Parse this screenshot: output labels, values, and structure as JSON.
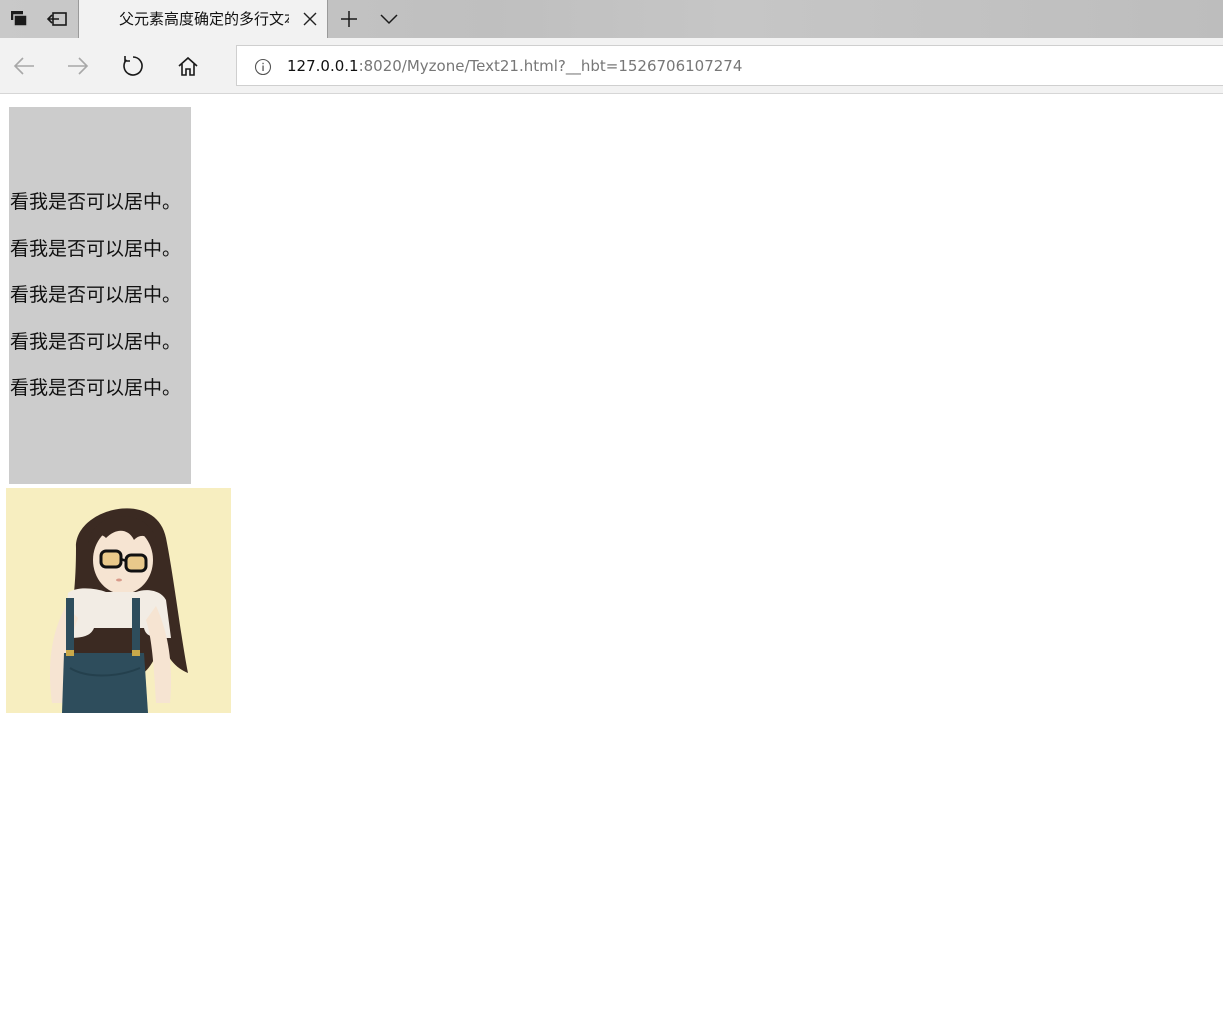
{
  "browser": {
    "tab": {
      "title": "父元素高度确定的多行文本垂直居中"
    },
    "toolbar_icons": [
      "tab-manager-icon",
      "set-aside-tabs-icon",
      "new-tab-icon",
      "tab-preview-chevron-icon"
    ],
    "nav_icons": [
      "back-arrow-icon",
      "forward-arrow-icon",
      "refresh-icon",
      "home-icon",
      "info-icon"
    ],
    "address": {
      "host": "127.0.0.1",
      "rest": ":8020/Myzone/Text21.html?__hbt=1526706107274"
    }
  },
  "page": {
    "lines": [
      "看我是否可以居中。",
      "看我是否可以居中。",
      "看我是否可以居中。",
      "看我是否可以居中。",
      "看我是否可以居中。"
    ],
    "box_color": "#cccccc",
    "image": {
      "subject": "girl-with-glasses-illustration",
      "background_color": "#f7eec0"
    }
  }
}
